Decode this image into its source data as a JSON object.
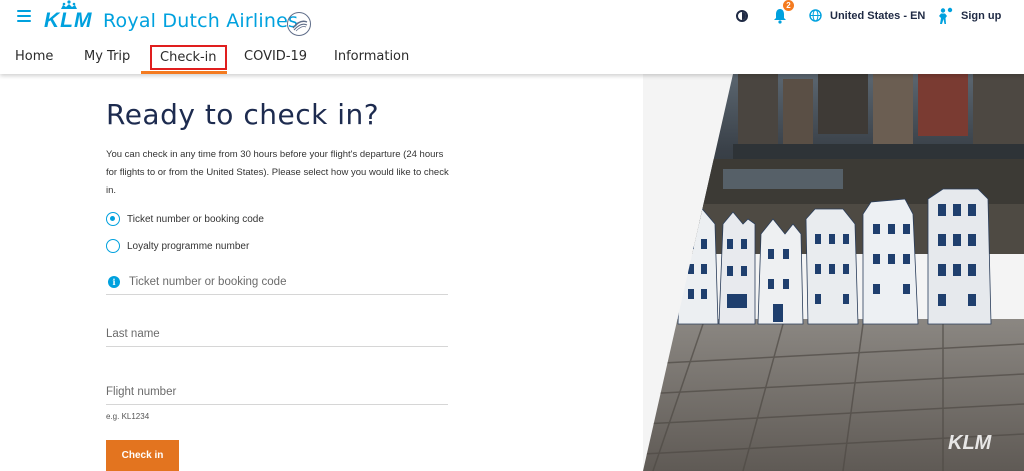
{
  "header": {
    "brand_logo_text": "KLM",
    "brand_name": "Royal Dutch Airlines",
    "notification_count": "2",
    "country_language": "United States - EN",
    "signup_label": "Sign up"
  },
  "nav": {
    "items": [
      {
        "label": "Home"
      },
      {
        "label": "My Trip"
      },
      {
        "label": "Check-in"
      },
      {
        "label": "COVID-19"
      },
      {
        "label": "Information"
      }
    ],
    "active": "Check-in"
  },
  "main": {
    "title": "Ready to check in?",
    "intro": "You can check in any time from 30 hours before your flight's departure (24 hours for flights to or from the United States). Please select how you would like to check in.",
    "radio_options": [
      {
        "label": "Ticket number or booking code",
        "checked": true
      },
      {
        "label": "Loyalty programme number",
        "checked": false
      }
    ],
    "fields": {
      "ticket_placeholder": "Ticket number or booking code",
      "lastname_placeholder": "Last name",
      "flight_placeholder": "Flight number",
      "flight_hint": "e.g. KL1234"
    },
    "checkin_button": "Check in"
  },
  "photo": {
    "watermark": "KLM"
  },
  "colors": {
    "brand_blue": "#00a1de",
    "accent_orange": "#e3741f",
    "title_navy": "#1d2b4f",
    "highlight_red": "#e01e1e"
  },
  "icons": [
    "menu-icon",
    "crown-icon",
    "skyteam-icon",
    "contrast-icon",
    "bell-icon",
    "globe-icon",
    "person-icon",
    "info-icon"
  ]
}
